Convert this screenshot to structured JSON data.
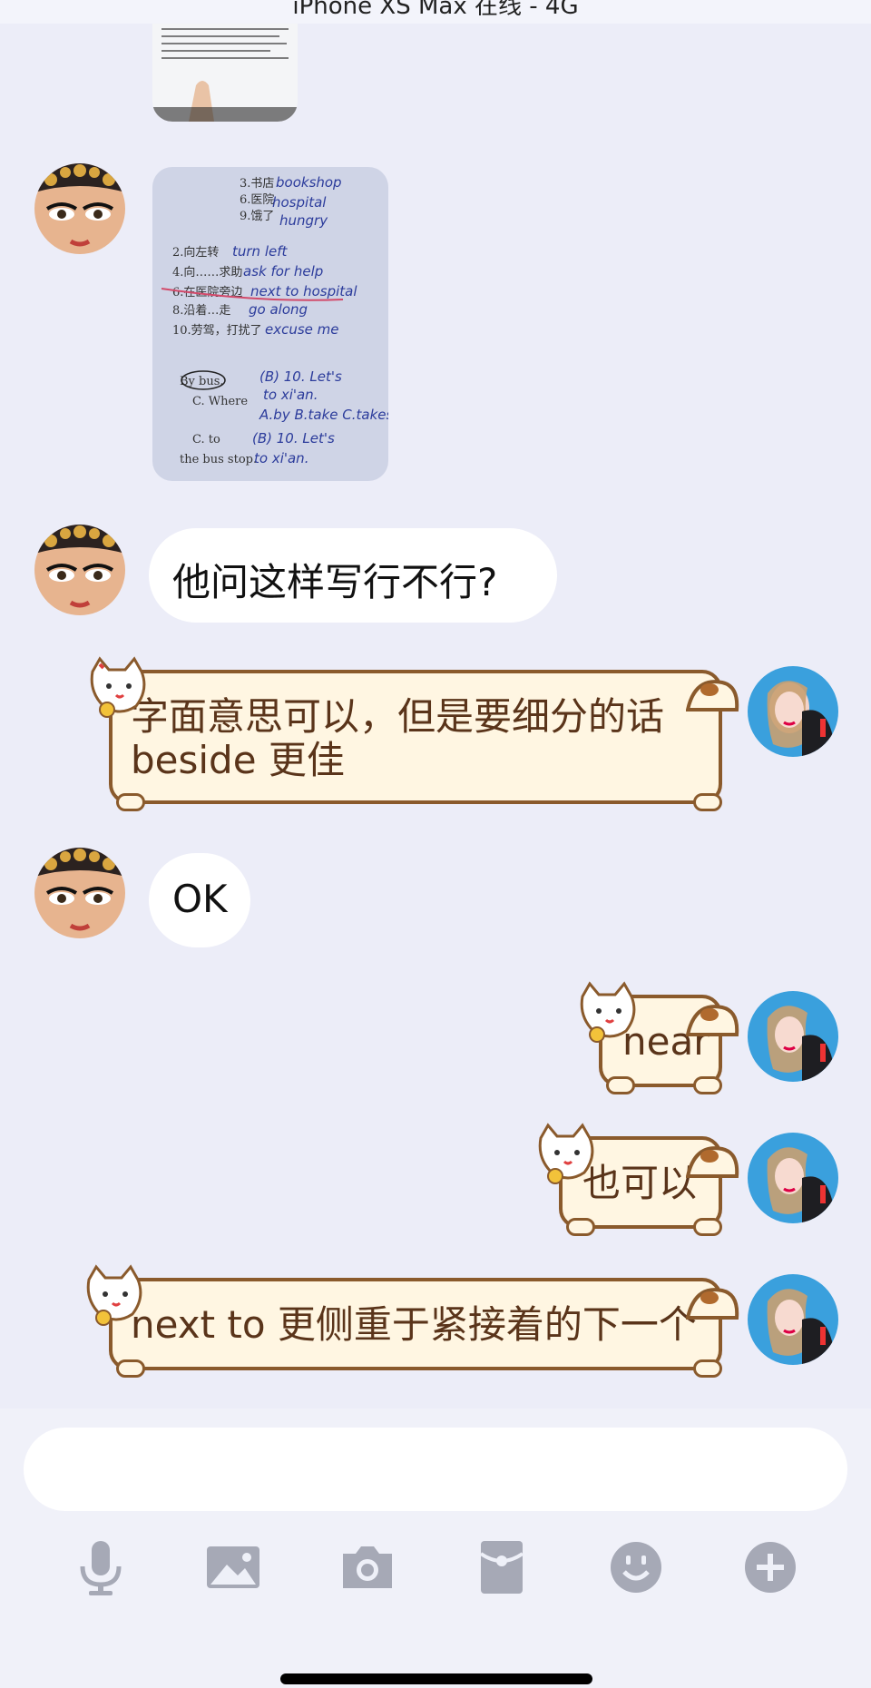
{
  "status_bar": {
    "title": "iPhone XS Max 在线 - 4G"
  },
  "messages": [
    {
      "id": "m1",
      "side": "left",
      "type": "image",
      "desc_icon": "worksheet-photo"
    },
    {
      "id": "m2",
      "side": "left",
      "type": "image",
      "desc_icon": "worksheet-photo",
      "image_text": [
        "3.书店 bookshop",
        "6.医院 hospital",
        "9.饿了 hungry",
        "2.向左转 turn left",
        "4.向……求助 ask for help",
        "6.在医院旁边 next to hospital",
        "8.沿着…走 go along…",
        "10.劳驾，打扰了 excuse me",
        "By bus.",
        "C. Where",
        "C. to",
        "the bus stop."
      ]
    },
    {
      "id": "m3",
      "side": "left",
      "type": "text",
      "text": "他问这样写行不行?"
    },
    {
      "id": "m4",
      "side": "right",
      "type": "cat-text",
      "text": "字面意思可以，但是要细分的话\nbeside 更佳"
    },
    {
      "id": "m5",
      "side": "left",
      "type": "text",
      "text": "OK"
    },
    {
      "id": "m6",
      "side": "right",
      "type": "cat-text",
      "text": "near"
    },
    {
      "id": "m7",
      "side": "right",
      "type": "cat-text",
      "text": "也可以"
    },
    {
      "id": "m8",
      "side": "right",
      "type": "cat-text",
      "text": "next to 更侧重于紧接着的下一个"
    }
  ],
  "input": {
    "placeholder": ""
  },
  "toolbar": {
    "items": [
      {
        "name": "microphone-icon"
      },
      {
        "name": "image-icon"
      },
      {
        "name": "camera-icon"
      },
      {
        "name": "red-packet-icon"
      },
      {
        "name": "emoji-icon"
      },
      {
        "name": "plus-icon"
      }
    ]
  },
  "colors": {
    "background": "#ecedf8",
    "cat_bubble_fill": "#fff6e2",
    "cat_bubble_border": "#8a5a2c",
    "icon_gray": "#a6a9b6"
  }
}
